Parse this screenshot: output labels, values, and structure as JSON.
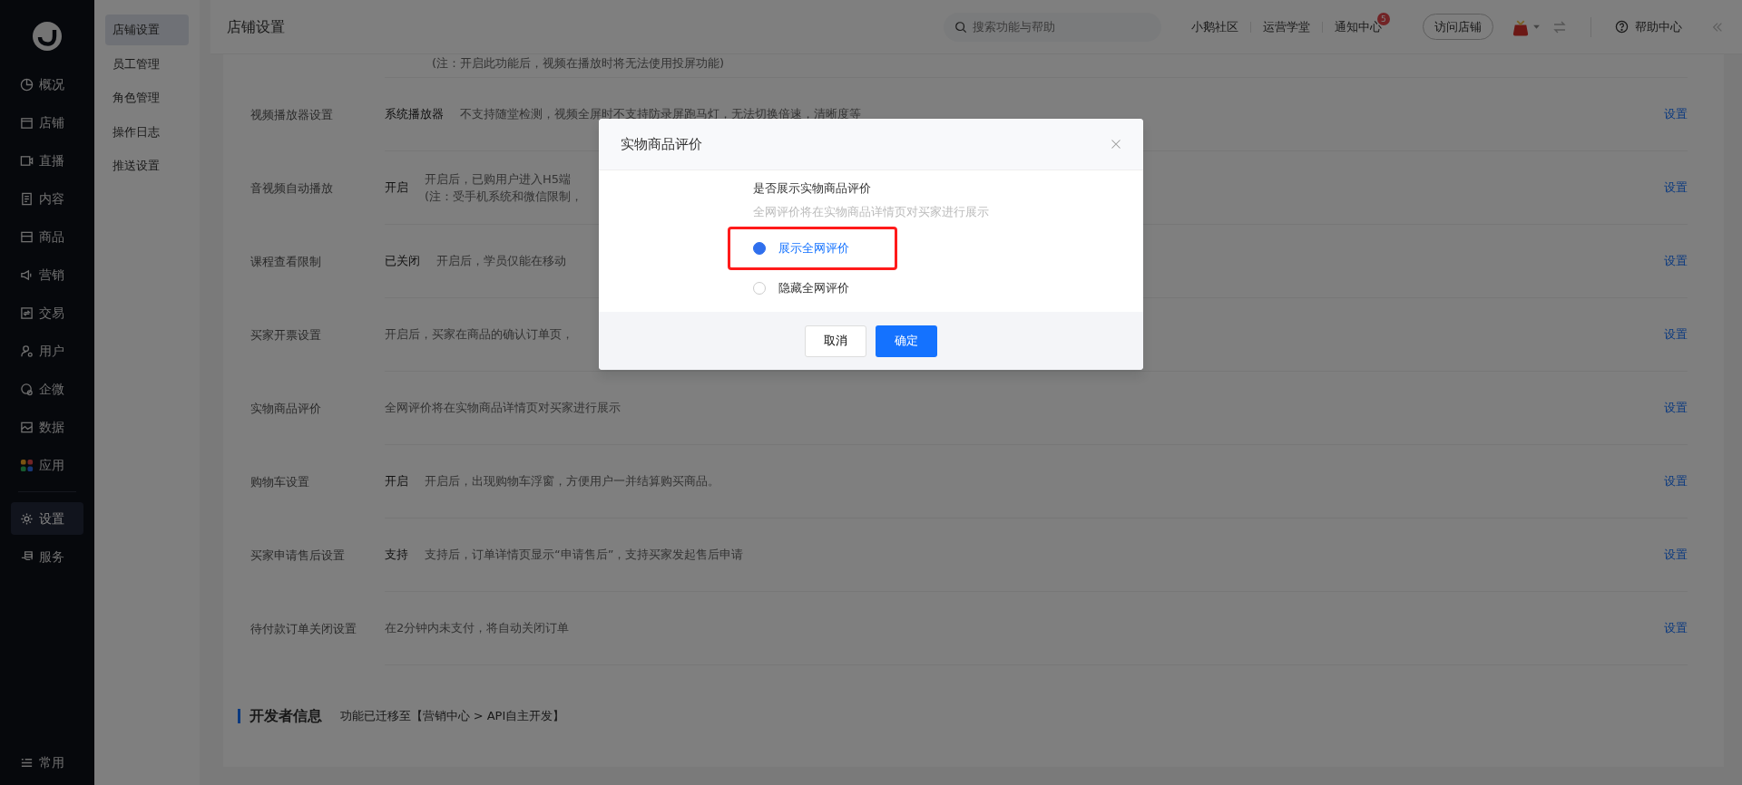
{
  "side_nav": {
    "items": [
      {
        "label": "概况",
        "selected": false
      },
      {
        "label": "店铺",
        "selected": false
      },
      {
        "label": "直播",
        "selected": false
      },
      {
        "label": "内容",
        "selected": false
      },
      {
        "label": "商品",
        "selected": false
      },
      {
        "label": "营销",
        "selected": false
      },
      {
        "label": "交易",
        "selected": false
      },
      {
        "label": "用户",
        "selected": false
      },
      {
        "label": "企微",
        "selected": false
      },
      {
        "label": "数据",
        "selected": false
      },
      {
        "label": "应用",
        "selected": false
      },
      {
        "label": "设置",
        "selected": true
      },
      {
        "label": "服务",
        "selected": false
      }
    ],
    "footer": "常用"
  },
  "sub_nav": {
    "items": [
      {
        "label": "店铺设置",
        "selected": true
      },
      {
        "label": "员工管理",
        "selected": false
      },
      {
        "label": "角色管理",
        "selected": false
      },
      {
        "label": "操作日志",
        "selected": false
      },
      {
        "label": "推送设置",
        "selected": false
      }
    ]
  },
  "header": {
    "title": "店铺设置",
    "search": {
      "placeholder": "搜索功能与帮助"
    },
    "links": [
      "小鹅社区",
      "运营学堂",
      "通知中心"
    ],
    "notification_count": "5",
    "visit_button": "访问店铺",
    "help": "帮助中心"
  },
  "settings": {
    "top_note": "(注：开启此功能后，视频在播放时将无法使用投屏功能)",
    "rows": [
      {
        "label": "视频播放器设置",
        "status": "系统播放器",
        "lines": [
          "不支持随堂检测，视频全屏时不支持防录屏跑马灯，无法切换倍速，清晰度等"
        ],
        "action": "设置"
      },
      {
        "label": "音视频自动播放",
        "status": "开启",
        "lines": [
          "开启后，已购用户进入H5端",
          "(注：受手机系统和微信限制，"
        ],
        "action": "设置"
      },
      {
        "label": "课程查看限制",
        "status": "已关闭",
        "lines": [
          "开启后，学员仅能在移动"
        ],
        "action": "设置"
      },
      {
        "label": "买家开票设置",
        "lines": [
          "开启后，买家在商品的确认订单页，"
        ],
        "action": "设置"
      },
      {
        "label": "实物商品评价",
        "lines": [
          "全网评价将在实物商品详情页对买家进行展示"
        ],
        "action": "设置"
      },
      {
        "label": "购物车设置",
        "status": "开启",
        "lines": [
          "开启后，出现购物车浮窗，方便用户一并结算购买商品。"
        ],
        "action": "设置"
      },
      {
        "label": "买家申请售后设置",
        "status": "支持",
        "lines": [
          "支持后，订单详情页显示“申请售后”，支持买家发起售后申请"
        ],
        "action": "设置"
      },
      {
        "label": "待付款订单关闭设置",
        "lines": [
          "在2分钟内未支付，将自动关闭订单"
        ],
        "action": "设置"
      }
    ]
  },
  "developer": {
    "title": "开发者信息",
    "note": "功能已迁移至【营销中心 > API自主开发】"
  },
  "dialog": {
    "title": "实物商品评价",
    "question": "是否展示实物商品评价",
    "hint": "全网评价将在实物商品详情页对买家进行展示",
    "options": [
      {
        "label": "展示全网评价",
        "selected": true
      },
      {
        "label": "隐藏全网评价",
        "selected": false
      }
    ],
    "cancel": "取消",
    "confirm": "确定"
  }
}
